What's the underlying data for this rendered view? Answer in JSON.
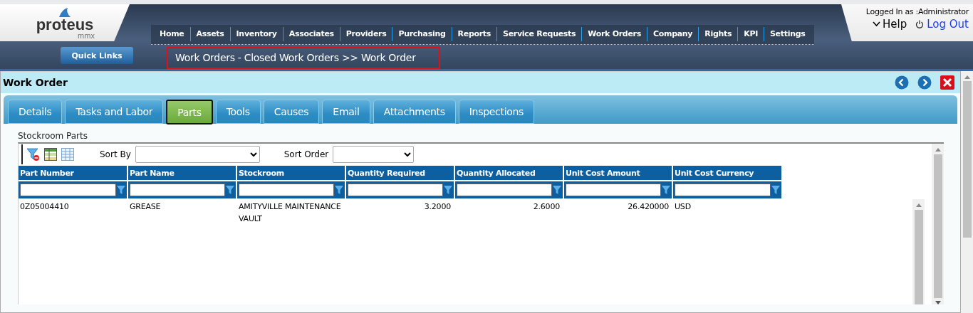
{
  "header": {
    "logo_text": "proteus",
    "logo_subtext": "mmx",
    "nav": [
      "Home",
      "Assets",
      "Inventory",
      "Associates",
      "Providers",
      "Purchasing",
      "Reports",
      "Service Requests",
      "Work Orders",
      "Company",
      "Rights",
      "KPI",
      "Settings"
    ],
    "quick_links": "Quick Links",
    "breadcrumb": "Work Orders - Closed Work Orders >> Work Order",
    "user": "Logged In as :Administrator",
    "help": "Help",
    "logout": "Log Out"
  },
  "panel": {
    "title": "Work Order",
    "tabs": [
      {
        "label": "Details",
        "selected": false
      },
      {
        "label": "Tasks and Labor",
        "selected": false
      },
      {
        "label": "Parts",
        "selected": true
      },
      {
        "label": "Tools",
        "selected": false
      },
      {
        "label": "Causes",
        "selected": false
      },
      {
        "label": "Email",
        "selected": false
      },
      {
        "label": "Attachments",
        "selected": false
      },
      {
        "label": "Inspections",
        "selected": false
      }
    ],
    "section_title": "Stockroom Parts",
    "sort_by_label": "Sort By",
    "sort_order_label": "Sort Order",
    "columns": [
      {
        "label": "Part Number",
        "kind": "text"
      },
      {
        "label": "Part Name",
        "kind": "text"
      },
      {
        "label": "Stockroom",
        "kind": "text"
      },
      {
        "label": "Quantity Required",
        "kind": "number"
      },
      {
        "label": "Quantity Allocated",
        "kind": "number"
      },
      {
        "label": "Unit Cost Amount",
        "kind": "number"
      },
      {
        "label": "Unit Cost Currency",
        "kind": "text"
      }
    ],
    "rows": [
      {
        "cells": [
          "0Z05004410",
          "GREASE",
          "AMITYVILLE MAINTENANCE VAULT",
          "3.2000",
          "2.6000",
          "26.420000",
          "USD"
        ]
      }
    ]
  }
}
